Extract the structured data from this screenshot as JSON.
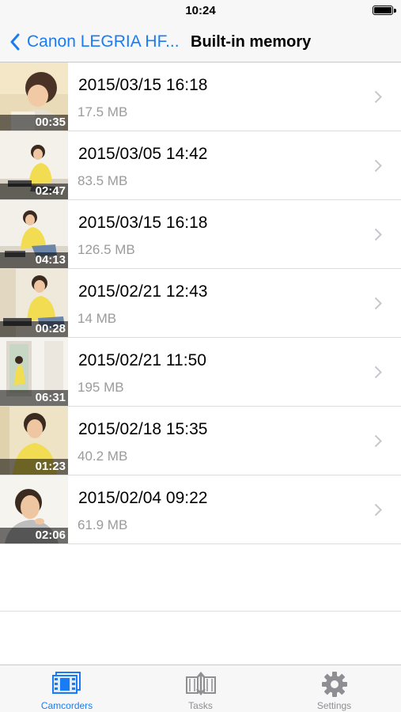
{
  "status_bar": {
    "time": "10:24"
  },
  "nav": {
    "back_label": "Canon LEGRIA HF...",
    "title": "Built-in memory"
  },
  "recordings": [
    {
      "date": "2015/03/15 16:18",
      "size": "17.5 MB",
      "duration": "00:35"
    },
    {
      "date": "2015/03/05 14:42",
      "size": "83.5 MB",
      "duration": "02:47"
    },
    {
      "date": "2015/03/15 16:18",
      "size": "126.5 MB",
      "duration": "04:13"
    },
    {
      "date": "2015/02/21 12:43",
      "size": "14 MB",
      "duration": "00:28"
    },
    {
      "date": "2015/02/21 11:50",
      "size": "195 MB",
      "duration": "06:31"
    },
    {
      "date": "2015/02/18 15:35",
      "size": "40.2 MB",
      "duration": "01:23"
    },
    {
      "date": "2015/02/04 09:22",
      "size": "61.9 MB",
      "duration": "02:06"
    }
  ],
  "tab_bar": {
    "tabs": [
      {
        "label": "Camcorders",
        "icon": "film-icon",
        "active": true
      },
      {
        "label": "Tasks",
        "icon": "transfer-icon",
        "active": false
      },
      {
        "label": "Settings",
        "icon": "gear-icon",
        "active": false
      }
    ]
  },
  "colors": {
    "accent": "#1a7cf5",
    "inactive": "#8e8e93",
    "secondary_text": "#9b9b9b"
  }
}
